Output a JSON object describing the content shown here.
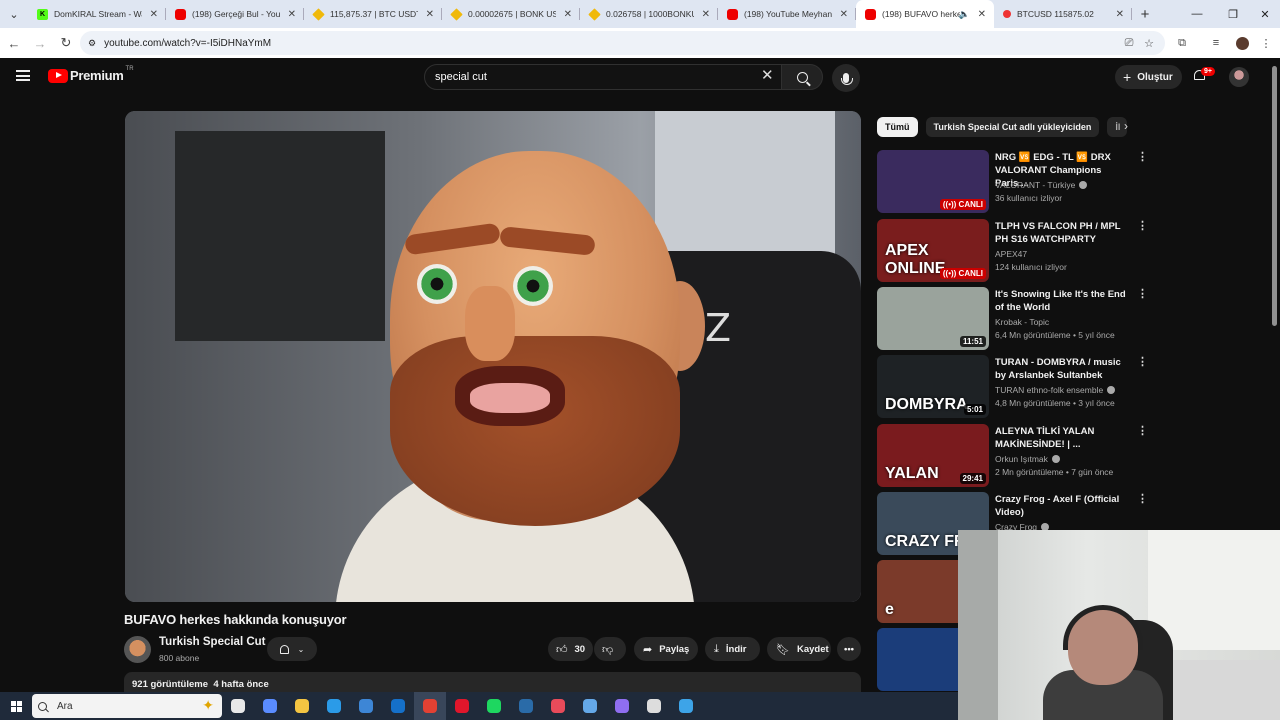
{
  "browser": {
    "tabs": [
      {
        "title": "DomKIRAL Stream - Watc",
        "icon": "kick-icon"
      },
      {
        "title": "(198) Gerçeği Bul - YouTu",
        "icon": "youtube-icon"
      },
      {
        "title": "115,875.37 | BTC USDT | B",
        "icon": "coin-icon"
      },
      {
        "title": "0.00002675 | BONK USDT",
        "icon": "coin-icon"
      },
      {
        "title": "0.026758 | 1000BONKUSD",
        "icon": "coin-icon"
      },
      {
        "title": "(198) YouTube Meyhanes",
        "icon": "youtube-icon"
      },
      {
        "title": "(198) BUFAVO herkes",
        "icon": "youtube-icon",
        "active": true
      },
      {
        "title": "BTCUSD 115875.02",
        "icon": "chart-icon"
      }
    ],
    "url": "youtube.com/watch?v=-I5iDHNaYmM"
  },
  "youtube": {
    "logo_text": "Premium",
    "logo_region": "TR",
    "search_query": "special cut",
    "create_label": "Oluştur",
    "notification_count": "9+"
  },
  "video": {
    "title": "BUFAVO herkes hakkında konuşuyor",
    "channel": "Turkish Special Cut",
    "subscribers": "800 abone",
    "likes": "30",
    "share_label": "Paylaş",
    "download_label": "İndir",
    "save_label": "Kaydet",
    "views": "921 görüntüleme",
    "age": "4 hafta önce"
  },
  "sidebar": {
    "chips": [
      "Tümü",
      "Turkish Special Cut adlı yükleyiciden",
      "İl"
    ],
    "recommendations": [
      {
        "title": "NRG 🆚 EDG - TL 🆚 DRX VALORANT Champions Paris ...",
        "channel": "VALORANT - Türkiye",
        "verified": true,
        "stats": "36 kullanıcı izliyor",
        "badge": "CANLI",
        "live": true,
        "thumb_color": "#3a2b5e"
      },
      {
        "title": "TLPH VS FALCON PH / MPL PH S16 WATCHPARTY",
        "channel": "APEX47",
        "verified": false,
        "stats": "124 kullanıcı izliyor",
        "badge": "CANLI",
        "live": true,
        "thumb_color": "#7a1d1d",
        "overlay": "APEX ONLINE"
      },
      {
        "title": "It's Snowing Like It's the End of the World",
        "channel": "Krobak - Topic",
        "verified": false,
        "stats": "6,4 Mn görüntüleme • 5 yıl önce",
        "badge": "11:51",
        "live": false,
        "thumb_color": "#9aa39c"
      },
      {
        "title": "TURAN - DOMBYRA / music by Arslanbek Sultanbek",
        "channel": "TURAN ethno-folk ensemble",
        "verified": true,
        "stats": "4,8 Mn görüntüleme • 3 yıl önce",
        "badge": "5:01",
        "live": false,
        "thumb_color": "#1e2225",
        "overlay": "DOMBYRA"
      },
      {
        "title": "ALEYNA TİLKİ YALAN MAKİNESİNDE! | ...",
        "channel": "Orkun Işıtmak",
        "verified": true,
        "stats": "2 Mn görüntüleme • 7 gün önce",
        "badge": "29:41",
        "live": false,
        "thumb_color": "#7a1b1e",
        "overlay": "YALAN"
      },
      {
        "title": "Crazy Frog - Axel F (Official Video)",
        "channel": "Crazy Frog",
        "verified": true,
        "stats": "",
        "badge": "",
        "live": false,
        "thumb_color": "#3a4a5a",
        "overlay": "CRAZY FRO"
      },
      {
        "title": "",
        "channel": "",
        "verified": false,
        "stats": "",
        "badge": "",
        "live": false,
        "thumb_color": "#7b3a2a",
        "overlay": "e"
      },
      {
        "title": "",
        "channel": "",
        "verified": false,
        "stats": "",
        "badge": "",
        "live": false,
        "thumb_color": "#1b3d7a"
      }
    ]
  },
  "taskbar": {
    "search_placeholder": "Ara",
    "apps": [
      {
        "name": "task-view-icon",
        "color": "#e8e8e8"
      },
      {
        "name": "copilot-icon",
        "color": "#5a8cff"
      },
      {
        "name": "file-explorer-icon",
        "color": "#f4c542"
      },
      {
        "name": "edge-icon",
        "color": "#2b9be8"
      },
      {
        "name": "store-icon",
        "color": "#3d86d6"
      },
      {
        "name": "outlook-icon",
        "color": "#1570c9"
      },
      {
        "name": "chrome-icon",
        "color": "#e34133",
        "active": true
      },
      {
        "name": "opera-icon",
        "color": "#e0162b"
      },
      {
        "name": "spotify-icon",
        "color": "#1ed760"
      },
      {
        "name": "steam-icon",
        "color": "#2a6ba8"
      },
      {
        "name": "launcher-icon",
        "color": "#e84b5a"
      },
      {
        "name": "bluetooth-app-icon",
        "color": "#64a8e8"
      },
      {
        "name": "discord-icon",
        "color": "#8f6ef0"
      },
      {
        "name": "obs-icon",
        "color": "#dddddd"
      },
      {
        "name": "paint-icon",
        "color": "#3da4e8"
      }
    ]
  }
}
